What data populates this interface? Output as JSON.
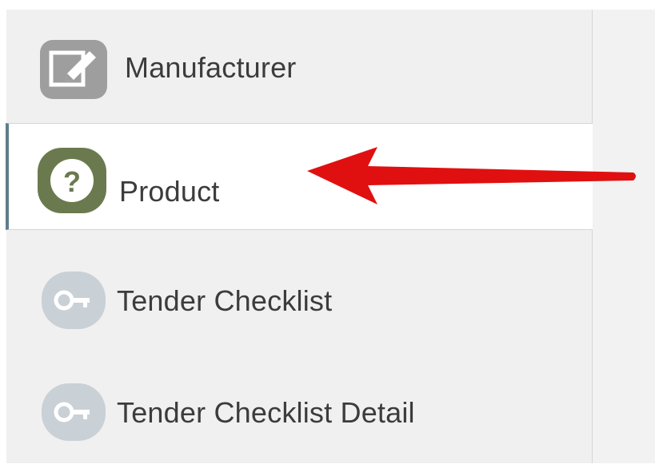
{
  "sidebar": {
    "items": [
      {
        "label": "Manufacturer",
        "icon": "edit-icon",
        "active": false
      },
      {
        "label": "Product",
        "icon": "question-icon",
        "active": true
      },
      {
        "label": "Tender Checklist",
        "icon": "key-icon",
        "active": false
      },
      {
        "label": "Tender Checklist Detail",
        "icon": "key-icon",
        "active": false
      }
    ]
  },
  "colors": {
    "sidebar_bg": "#f0f0f0",
    "active_bg": "#ffffff",
    "active_border": "#5e7d8c",
    "product_icon": "#6b7a4e",
    "edit_icon": "#9e9e9e",
    "key_icon": "#c9d0d6",
    "arrow": "#e01010"
  }
}
